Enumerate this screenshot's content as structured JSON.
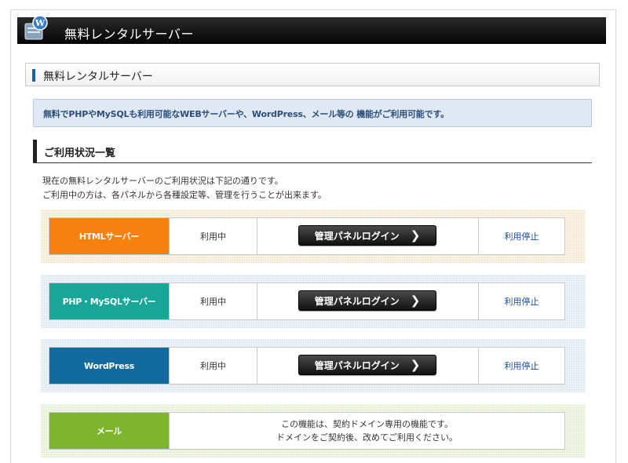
{
  "header": {
    "title": "無料レンタルサーバー",
    "icon": "wordpress-server-icon"
  },
  "section": {
    "title": "無料レンタルサーバー"
  },
  "notice": {
    "text": "無料でPHPやMySQLも利用可能なWEBサーバーや、WordPress、メール等の 機能がご利用可能です。"
  },
  "usage": {
    "title": "ご利用状況一覧",
    "desc_line1": "現在の無料レンタルサーバーのご利用状況は下記の通りです。",
    "desc_line2": "ご利用中の方は、各パネルから各種設定等、管理を行うことが出来ます。"
  },
  "services": [
    {
      "name": "HTMLサーバー",
      "status": "利用中",
      "login_label": "管理パネルログイン",
      "stop_label": "利用停止",
      "color": "#f7810f"
    },
    {
      "name": "PHP・MySQLサーバー",
      "status": "利用中",
      "login_label": "管理パネルログイン",
      "stop_label": "利用停止",
      "color": "#17a697"
    },
    {
      "name": "WordPress",
      "status": "利用中",
      "login_label": "管理パネルログイン",
      "stop_label": "利用停止",
      "color": "#126b9e"
    }
  ],
  "mail": {
    "name": "メール",
    "color": "#7db52f",
    "msg_line1": "この機能は、契約ドメイン専用の機能です。",
    "msg_line2": "ドメインをご契約後、改めてご利用ください。"
  }
}
